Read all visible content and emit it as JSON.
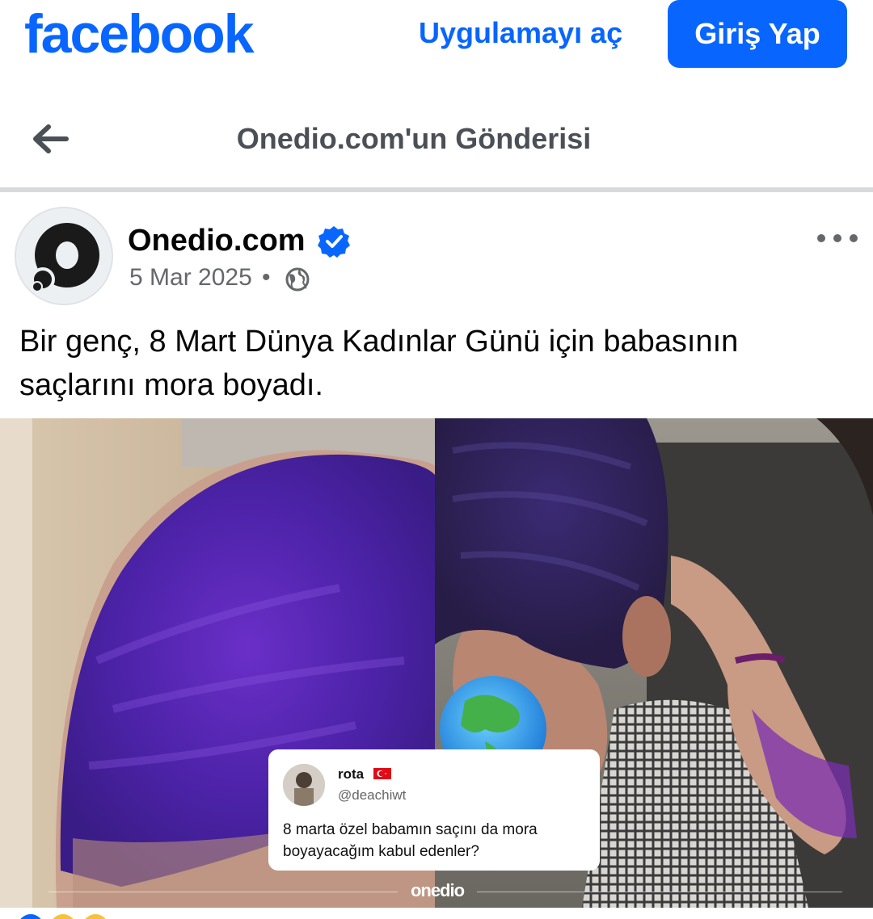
{
  "topbar": {
    "logo_text": "facebook",
    "open_app_label": "Uygulamayı aç",
    "login_label": "Giriş Yap",
    "brand_color": "#0866ff"
  },
  "header": {
    "back_icon": "arrow-left-icon",
    "title": "Onedio.com'un Gönderisi"
  },
  "post": {
    "author": "Onedio.com",
    "verified_icon": "verified-badge-icon",
    "date": "5 Mar 2025",
    "separator": "•",
    "privacy_icon": "globe-icon",
    "more_icon": "more-options-icon",
    "text": "Bir genç, 8 Mart Dünya Kadınlar Günü için babasının saçlarını mora boyadı."
  },
  "image": {
    "tweet": {
      "name": "rota",
      "flag_icon": "turkey-flag-icon",
      "handle": "@deachiwt",
      "text": "8 marta özel babamın saçını da mora boyayacağım kabul edenler?"
    },
    "watermark": "onedio",
    "globe_icon": "earth-globe-icon"
  }
}
